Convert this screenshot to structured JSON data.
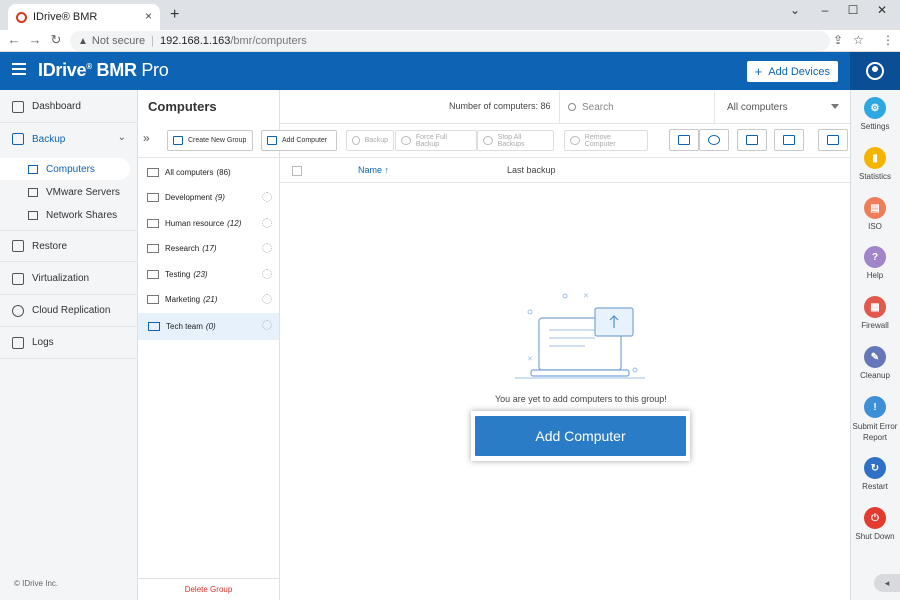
{
  "browser": {
    "tab_title": "IDrive® BMR",
    "tab_close": "×",
    "new_tab": "+",
    "minimize": "⌄",
    "restore": "–",
    "maximize": "☐",
    "close": "✕",
    "back": "←",
    "forward": "→",
    "reload": "↻",
    "security_icon": "▲",
    "not_secure": "Not secure",
    "separator": "|",
    "url_host": "192.168.1.163",
    "url_path": "/bmr/computers",
    "share": "⇪",
    "bookmark": "☆",
    "menu": "⋮"
  },
  "header": {
    "logo_main": "IDrive",
    "logo_reg": "®",
    "logo_bmr": " BMR ",
    "logo_pro": "Pro",
    "add_devices_plus": "+",
    "add_devices": "Add Devices"
  },
  "leftnav": {
    "items": [
      {
        "label": "Dashboard"
      },
      {
        "label": "Backup",
        "chevron": "⌄"
      },
      {
        "label": "Restore"
      },
      {
        "label": "Virtualization"
      },
      {
        "label": "Cloud Replication"
      },
      {
        "label": "Logs"
      }
    ],
    "sub_items": [
      {
        "label": "Computers"
      },
      {
        "label": "VMware Servers"
      },
      {
        "label": "Network Shares"
      }
    ],
    "copyright": "© IDrive Inc."
  },
  "page": {
    "title": "Computers",
    "collapse": "»",
    "count": "Number of computers: 86",
    "search_placeholder": "Search",
    "filter_value": "All computers"
  },
  "groups": [
    {
      "name": "All computers",
      "count": "(86)"
    },
    {
      "name": "Development",
      "count": "(9)"
    },
    {
      "name": "Human resource",
      "count": "(12)"
    },
    {
      "name": "Research",
      "count": "(17)"
    },
    {
      "name": "Testing",
      "count": "(23)"
    },
    {
      "name": "Marketing",
      "count": "(21)"
    },
    {
      "name": "Tech team",
      "count": "(0)"
    }
  ],
  "delete_group": "Delete Group",
  "toolbar": {
    "create_group": "Create New Group",
    "add_computer": "Add Computer",
    "backup": "Backup",
    "force_full_backup": "Force Full Backup",
    "stop_all_backups": "Stop All Backups",
    "remove_computer": "Remove Computer"
  },
  "table": {
    "col_name": "Name",
    "sort_arrow": "↑",
    "col_last_backup": "Last backup"
  },
  "empty": {
    "message": "You are yet to add computers to this group!",
    "button": "Add Computer"
  },
  "rail": {
    "items": [
      {
        "label": "Settings",
        "color": "#2ea8e0",
        "glyph": "⚙"
      },
      {
        "label": "Statistics",
        "color": "#f4b400",
        "glyph": "▮"
      },
      {
        "label": "ISO",
        "color": "#ef7d5a",
        "glyph": "▤"
      },
      {
        "label": "Help",
        "color": "#a085c9",
        "glyph": "?"
      },
      {
        "label": "Firewall",
        "color": "#e2584d",
        "glyph": "▦"
      },
      {
        "label": "Cleanup",
        "color": "#6677b8",
        "glyph": "✎"
      },
      {
        "label": "Submit Error Report",
        "color": "#3d8fd8",
        "glyph": "!"
      },
      {
        "label": "Restart",
        "color": "#2f6fc7",
        "glyph": "↻"
      },
      {
        "label": "Shut Down",
        "color": "#e33b2f",
        "glyph": "⏻"
      }
    ],
    "collapse": "◂"
  },
  "colors": {
    "brand": "#0d64b4",
    "primary_button": "#2b7cc6",
    "danger": "#d93025"
  }
}
